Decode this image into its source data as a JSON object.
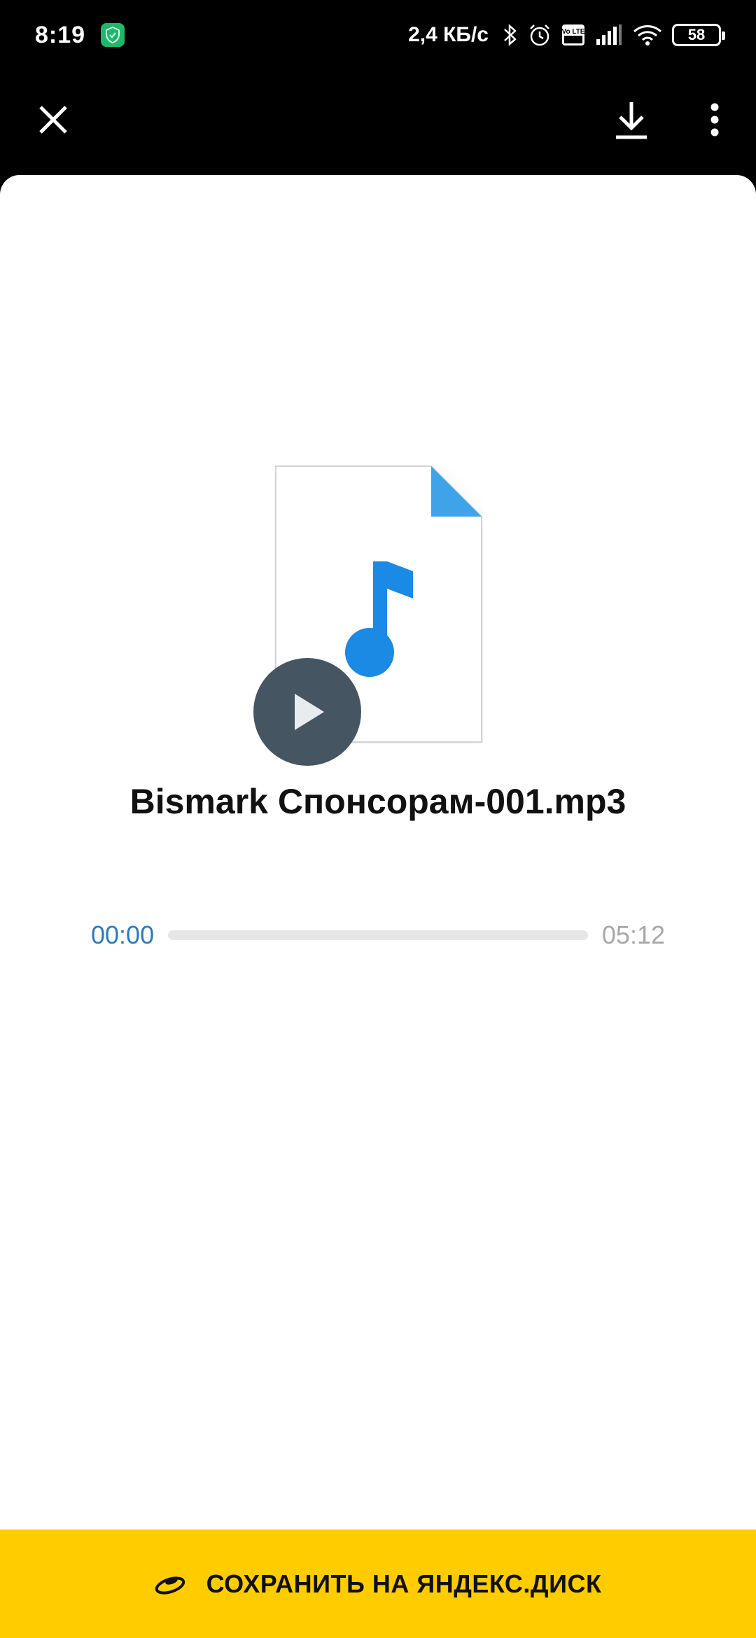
{
  "status_bar": {
    "time": "8:19",
    "net_speed": "2,4 КБ/с",
    "volte_label": "Vo LTE",
    "battery": "58"
  },
  "top_bar": {
    "close_icon": "close-icon",
    "download_icon": "download-icon",
    "more_icon": "more-vertical-icon"
  },
  "file": {
    "name": "Bismark Спонсорам-001.mp3",
    "type_icon": "music-note-icon"
  },
  "player": {
    "current_time": "00:00",
    "total_time": "05:12",
    "progress": 0
  },
  "save_button": {
    "label": "СОХРАНИТЬ НА ЯНДЕКС.ДИСК",
    "icon": "yandex-disk-icon"
  },
  "colors": {
    "accent_blue": "#2a7bc1",
    "save_yellow": "#ffcc00",
    "play_bg": "#455562",
    "file_corner": "#3ea3e8",
    "note_blue": "#1a8ae4"
  }
}
